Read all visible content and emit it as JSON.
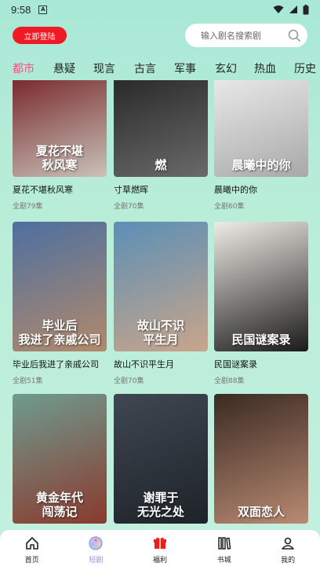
{
  "status_bar": {
    "time": "9:58",
    "notification_icon_label": "A"
  },
  "header": {
    "login_label": "立即登陆",
    "search_placeholder": "输入剧名搜索剧"
  },
  "tabs": [
    {
      "label": "都市",
      "active": true
    },
    {
      "label": "悬疑",
      "active": false
    },
    {
      "label": "现言",
      "active": false
    },
    {
      "label": "古言",
      "active": false
    },
    {
      "label": "军事",
      "active": false
    },
    {
      "label": "玄幻",
      "active": false
    },
    {
      "label": "热血",
      "active": false
    },
    {
      "label": "历史",
      "active": false
    }
  ],
  "dramas": [
    {
      "title": "夏花不堪秋风寒",
      "episodes": "全剧79集",
      "poster_text": "夏花不堪\n秋风寒",
      "colors": [
        "#7a2b2f",
        "#c9c2b9"
      ]
    },
    {
      "title": "寸草燃晖",
      "episodes": "全剧70集",
      "poster_text": "燃",
      "colors": [
        "#2a2a2a",
        "#6a6a6a"
      ]
    },
    {
      "title": "晨曦中的你",
      "episodes": "全剧60集",
      "poster_text": "晨曦中的你",
      "colors": [
        "#e8e8e8",
        "#a8a8a8"
      ]
    },
    {
      "title": "毕业后我进了亲戚公司",
      "episodes": "全剧51集",
      "poster_text": "毕业后\n我进了亲戚公司",
      "colors": [
        "#4d6fa1",
        "#b28a6a"
      ]
    },
    {
      "title": "故山不识平生月",
      "episodes": "全剧70集",
      "poster_text": "故山不识\n平生月",
      "colors": [
        "#5b8fb6",
        "#c9a58a"
      ]
    },
    {
      "title": "民国谜案录",
      "episodes": "全剧88集",
      "poster_text": "民国谜案录",
      "colors": [
        "#efece6",
        "#1a1a1a"
      ]
    },
    {
      "title": "",
      "episodes": "",
      "poster_text": "黄金年代\n闯荡记",
      "colors": [
        "#6f9b8f",
        "#8a3a2e"
      ]
    },
    {
      "title": "",
      "episodes": "",
      "poster_text": "谢罪于\n无光之处",
      "colors": [
        "#3f4752",
        "#1e2329"
      ]
    },
    {
      "title": "",
      "episodes": "",
      "poster_text": "双面恋人",
      "colors": [
        "#3a2a22",
        "#b98a73"
      ]
    }
  ],
  "bottom_nav": [
    {
      "label": "首页",
      "icon": "home-icon",
      "active": false
    },
    {
      "label": "短剧",
      "icon": "film-reel-icon",
      "active": true
    },
    {
      "label": "福利",
      "icon": "gift-icon",
      "active": false
    },
    {
      "label": "书城",
      "icon": "books-icon",
      "active": false
    },
    {
      "label": "我的",
      "icon": "user-icon",
      "active": false
    }
  ],
  "colors": {
    "accent": "#ff4e8a",
    "login_red": "#ee1b24",
    "nav_active": "#9b8fd9"
  }
}
